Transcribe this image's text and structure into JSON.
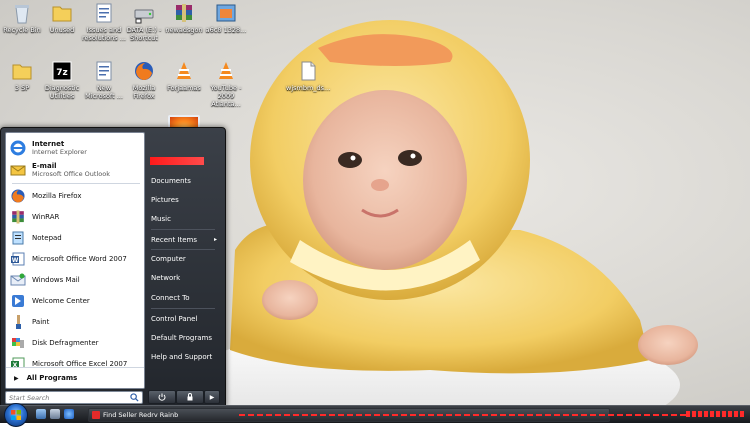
{
  "desktop": {
    "icons": [
      {
        "label": "Recycle Bin",
        "icon": "recycle-bin-icon"
      },
      {
        "label": "Unused",
        "icon": "folder-icon"
      },
      {
        "label": "Issues and resolutions ...",
        "icon": "document-icon"
      },
      {
        "label": "DATA (E:) - Shortcut",
        "icon": "drive-shortcut-icon"
      },
      {
        "label": "newadsgon",
        "icon": "winrar-archive-icon"
      },
      {
        "label": "a6c8 1328...",
        "icon": "image-file-icon"
      },
      {
        "label": "3 SP",
        "icon": "folder-icon"
      },
      {
        "label": "Diagnostic Utilities",
        "icon": "7zip-icon"
      },
      {
        "label": "New Microsoft ...",
        "icon": "document-icon"
      },
      {
        "label": "Mozilla Firefox",
        "icon": "firefox-icon"
      },
      {
        "label": "Forjaamas",
        "icon": "vlc-icon"
      },
      {
        "label": "YouTube - 2009 Atlanta...",
        "icon": "vlc-icon"
      },
      {
        "label": "wjsmbm_ds...",
        "icon": "blank-file-icon"
      }
    ]
  },
  "start_menu": {
    "pinned": [
      {
        "title": "Internet",
        "subtitle": "Internet Explorer",
        "icon": "internet-explorer-icon"
      },
      {
        "title": "E-mail",
        "subtitle": "Microsoft Office Outlook",
        "icon": "outlook-icon"
      }
    ],
    "recent": [
      {
        "label": "Mozilla Firefox",
        "icon": "firefox-icon"
      },
      {
        "label": "WinRAR",
        "icon": "winrar-icon"
      },
      {
        "label": "Notepad",
        "icon": "notepad-icon"
      },
      {
        "label": "Microsoft Office Word 2007",
        "icon": "word-icon"
      },
      {
        "label": "Windows Mail",
        "icon": "windows-mail-icon"
      },
      {
        "label": "Welcome Center",
        "icon": "welcome-center-icon"
      },
      {
        "label": "Paint",
        "icon": "paint-icon"
      },
      {
        "label": "Disk Defragmenter",
        "icon": "disk-defragmenter-icon"
      },
      {
        "label": "Microsoft Office Excel 2007",
        "icon": "excel-icon"
      }
    ],
    "all_programs": "All Programs",
    "search_placeholder": "Start Search",
    "right": [
      {
        "label": "Documents"
      },
      {
        "label": "Pictures"
      },
      {
        "label": "Music"
      },
      {
        "label": "Recent Items",
        "arrow": "▸"
      },
      {
        "label": "Computer"
      },
      {
        "label": "Network"
      },
      {
        "label": "Connect To"
      },
      {
        "label": "Control Panel"
      },
      {
        "label": "Default Programs"
      },
      {
        "label": "Help and Support"
      }
    ]
  },
  "taskbar": {
    "button_label": "Find Seller Redrv Rainb"
  },
  "colors": {
    "accent_red": "#ff2a2a",
    "start_menu_bg": "#2b3038",
    "orb_blue": "#2a6fcf"
  }
}
